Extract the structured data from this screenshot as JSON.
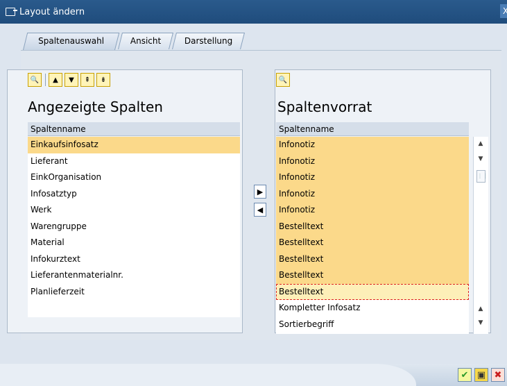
{
  "window": {
    "title": "Layout ändern",
    "close_label": "X"
  },
  "tabs": [
    {
      "label": "Spaltenauswahl",
      "active": true
    },
    {
      "label": "Ansicht",
      "active": false
    },
    {
      "label": "Darstellung",
      "active": false
    }
  ],
  "left": {
    "heading": "Angezeigte Spalten",
    "column_header": "Spaltenname",
    "toolbar_icons": [
      "find-icon",
      "move-up-icon",
      "move-down-icon",
      "move-top-icon",
      "move-bottom-icon"
    ],
    "rows": [
      {
        "label": "Einkaufsinfosatz",
        "selected": true
      },
      {
        "label": "Lieferant",
        "selected": false
      },
      {
        "label": "EinkOrganisation",
        "selected": false
      },
      {
        "label": "Infosatztyp",
        "selected": false
      },
      {
        "label": "Werk",
        "selected": false
      },
      {
        "label": "Warengruppe",
        "selected": false
      },
      {
        "label": "Material",
        "selected": false
      },
      {
        "label": "Infokurztext",
        "selected": false
      },
      {
        "label": "Lieferantenmaterialnr.",
        "selected": false
      },
      {
        "label": "Planlieferzeit",
        "selected": false
      }
    ]
  },
  "right": {
    "heading": "Spaltenvorrat",
    "column_header": "Spaltenname",
    "toolbar_icons": [
      "find-icon"
    ],
    "rows": [
      {
        "label": "Infonotiz",
        "selected": true
      },
      {
        "label": "Infonotiz",
        "selected": true
      },
      {
        "label": "Infonotiz",
        "selected": true
      },
      {
        "label": "Infonotiz",
        "selected": true
      },
      {
        "label": "Infonotiz",
        "selected": true
      },
      {
        "label": "Bestelltext",
        "selected": true
      },
      {
        "label": "Bestelltext",
        "selected": true
      },
      {
        "label": "Bestelltext",
        "selected": true
      },
      {
        "label": "Bestelltext",
        "selected": true
      },
      {
        "label": "Bestelltext",
        "selected": true,
        "focused": true
      },
      {
        "label": "Kompletter Infosatz",
        "selected": false
      },
      {
        "label": "Sortierbegriff",
        "selected": false
      }
    ]
  },
  "movers": {
    "to_right": "▶",
    "to_left": "◀"
  },
  "footer_buttons": [
    "confirm-icon",
    "save-icon",
    "cancel-icon"
  ],
  "colors": {
    "selection": "#fbd98a",
    "title_bar": "#1f4c7c"
  }
}
